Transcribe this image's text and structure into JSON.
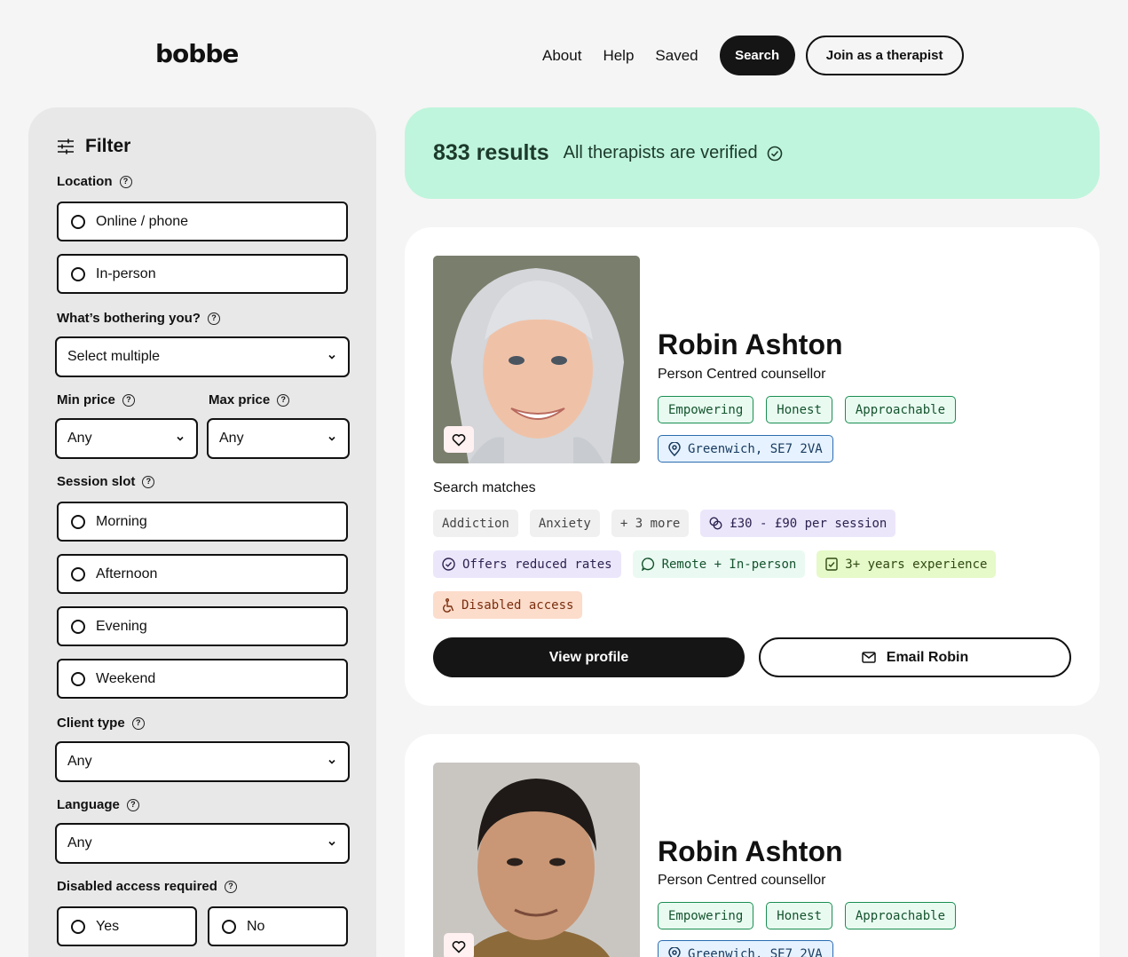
{
  "header": {
    "logo": "bobbe",
    "nav": [
      "About",
      "Help",
      "Saved"
    ],
    "search_label": "Search",
    "join_label": "Join as a therapist"
  },
  "filter": {
    "title": "Filter",
    "location_label": "Location",
    "location_options": [
      "Online / phone",
      "In-person"
    ],
    "bothering_label": "What’s bothering you?",
    "bothering_value": "Select multiple",
    "min_price_label": "Min price",
    "min_price_value": "Any",
    "max_price_label": "Max price",
    "max_price_value": "Any",
    "session_label": "Session slot",
    "session_options": [
      "Morning",
      "Afternoon",
      "Evening",
      "Weekend"
    ],
    "client_type_label": "Client type",
    "client_type_value": "Any",
    "language_label": "Language",
    "language_value": "Any",
    "access_label": "Disabled access required",
    "access_options": [
      "Yes",
      "No"
    ]
  },
  "results": {
    "count": "833 results",
    "verified_text": "All therapists are verified"
  },
  "cards": [
    {
      "name": "Robin Ashton",
      "role": "Person Centred counsellor",
      "tags": [
        "Empowering",
        "Honest",
        "Approachable"
      ],
      "location": "Greenwich, SE7 2VA",
      "matches_label": "Search matches",
      "chips": [
        "Addiction",
        "Anxiety",
        "+ 3 more"
      ],
      "price": "£30 - £90 per session",
      "reduced": "Offers reduced rates",
      "mode": "Remote + In-person",
      "experience": "3+ years experience",
      "access": "Disabled access",
      "view_label": "View profile",
      "email_label": "Email Robin"
    },
    {
      "name": "Robin Ashton",
      "role": "Person Centred counsellor",
      "tags": [
        "Empowering",
        "Honest",
        "Approachable"
      ],
      "location": "Greenwich, SE7 2VA"
    }
  ]
}
